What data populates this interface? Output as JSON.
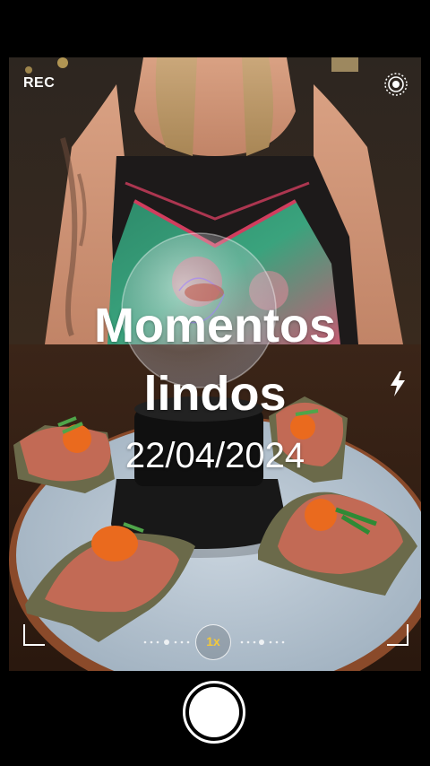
{
  "camera": {
    "rec_label": "REC",
    "zoom_label": "1x",
    "live_icon": "live-photo-icon",
    "flash_icon": "flash-icon",
    "shutter_icon": "shutter-button"
  },
  "caption": {
    "title_line1": "Momentos",
    "title_line2": "lindos",
    "date": "22/04/2024"
  },
  "colors": {
    "accent_zoom": "#f4c93a",
    "background": "#000000"
  }
}
